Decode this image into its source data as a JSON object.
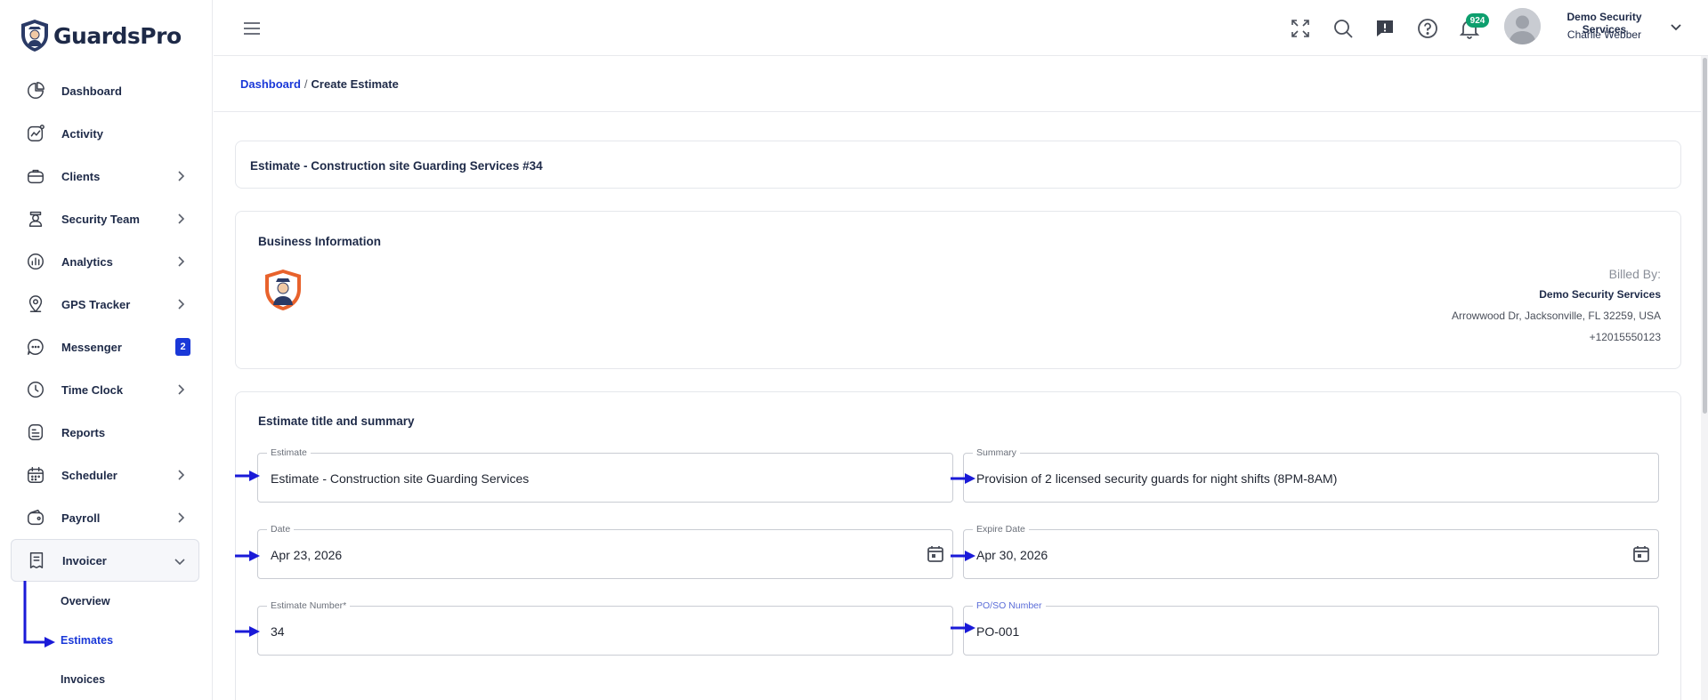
{
  "app": {
    "name": "GuardsPro"
  },
  "sidebar": {
    "items": [
      {
        "label": "Dashboard"
      },
      {
        "label": "Activity"
      },
      {
        "label": "Clients"
      },
      {
        "label": "Security Team"
      },
      {
        "label": "Analytics"
      },
      {
        "label": "GPS Tracker"
      },
      {
        "label": "Messenger",
        "badge": "2"
      },
      {
        "label": "Time Clock"
      },
      {
        "label": "Reports"
      },
      {
        "label": "Scheduler"
      },
      {
        "label": "Payroll"
      },
      {
        "label": "Invoicer"
      }
    ],
    "sub_items": [
      {
        "label": "Overview"
      },
      {
        "label": "Estimates"
      },
      {
        "label": "Invoices"
      }
    ]
  },
  "topbar": {
    "notification_count": "924",
    "user_company": "Demo Security Services",
    "user_name": "Charlie Webber"
  },
  "breadcrumb": {
    "link": "Dashboard",
    "separator": "/",
    "current": "Create Estimate"
  },
  "estimate_header": {
    "title": "Estimate - Construction site Guarding Services #34"
  },
  "business_info": {
    "title": "Business Information",
    "billed_by_label": "Billed By:",
    "company": "Demo Security Services",
    "address": "Arrowwood Dr, Jacksonville, FL 32259, USA",
    "phone": "+12015550123"
  },
  "estimate_form": {
    "title": "Estimate title and summary",
    "fields": {
      "estimate": {
        "label": "Estimate",
        "value": "Estimate - Construction site Guarding Services"
      },
      "summary": {
        "label": "Summary",
        "value": "Provision of 2 licensed security guards for night shifts (8PM-8AM)"
      },
      "date": {
        "label": "Date",
        "value": "Apr 23, 2026"
      },
      "expire_date": {
        "label": "Expire Date",
        "value": "Apr 30, 2026"
      },
      "estimate_number": {
        "label": "Estimate Number*",
        "value": "34"
      },
      "po_so_number": {
        "label": "PO/SO Number",
        "value": "PO-001"
      }
    }
  },
  "colors": {
    "primary": "#1a38d8",
    "brand_navy": "#1e2a48",
    "notification_badge": "#0e9f6e",
    "logo_orange": "#e8622c",
    "annotation_arrow": "#1a1ad8"
  },
  "icons": {
    "nav": [
      "dashboard-icon",
      "activity-icon",
      "clients-icon",
      "security-team-icon",
      "analytics-icon",
      "gps-icon",
      "messenger-icon",
      "clock-icon",
      "reports-icon",
      "scheduler-icon",
      "payroll-icon",
      "invoicer-icon"
    ],
    "topbar": [
      "menu-icon",
      "fullscreen-icon",
      "search-icon",
      "feedback-icon",
      "help-icon",
      "bell-icon"
    ]
  }
}
